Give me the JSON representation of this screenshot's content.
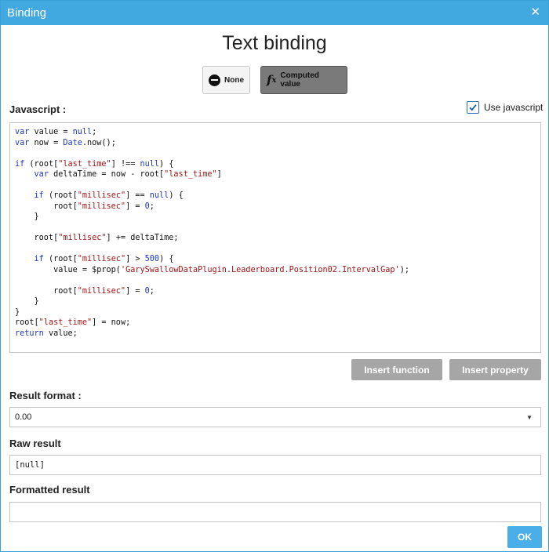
{
  "window": {
    "title": "Binding",
    "close_glyph": "✕"
  },
  "heading": "Text binding",
  "mode_buttons": {
    "none_label": "None",
    "computed_label": "Computed value",
    "none_icon": "none-icon",
    "computed_icon": "function-fx-icon",
    "active": "computed"
  },
  "javascript_label": "Javascript :",
  "use_javascript": {
    "label": "Use javascript",
    "checked": true
  },
  "code_lines": [
    "var value = null;",
    "var now = Date.now();",
    "",
    "if (root[\"last_time\"] !== null) {",
    "    var deltaTime = now - root[\"last_time\"]",
    "",
    "    if (root[\"millisec\"] == null) {",
    "        root[\"millisec\"] = 0;",
    "    }",
    "",
    "    root[\"millisec\"] += deltaTime;",
    "",
    "    if (root[\"millisec\"] > 500) {",
    "        value = $prop('GarySwallowDataPlugin.Leaderboard.Position02.IntervalGap');",
    "",
    "        root[\"millisec\"] = 0;",
    "    }",
    "}",
    "root[\"last_time\"] = now;",
    "return value;"
  ],
  "buttons": {
    "insert_function": "Insert function",
    "insert_property": "Insert property",
    "ok": "OK"
  },
  "result_format": {
    "label": "Result format :",
    "value": "0.00"
  },
  "raw_result": {
    "label": "Raw result",
    "value": "[null]"
  },
  "formatted_result": {
    "label": "Formatted result",
    "value": ""
  },
  "colors": {
    "titlebar": "#41a9e0",
    "accent_button": "#4aaee8",
    "disabled_button": "#a6a6a6",
    "keyword": "#1d35c8",
    "string": "#a31515"
  }
}
